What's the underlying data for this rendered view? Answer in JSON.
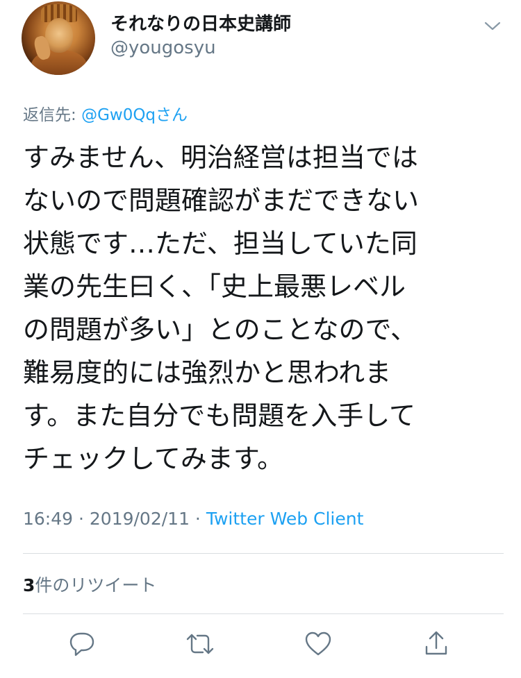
{
  "user": {
    "display_name": "それなりの日本史講師",
    "handle": "@yougosyu"
  },
  "reply": {
    "prefix": "返信先: ",
    "mention": "@Gw0Qqさん"
  },
  "tweet": {
    "text": "すみません、明治経営は担当では\nないので問題確認がまだできない\n状態です…ただ、担当していた同\n業の先生曰く、「史上最悪レベル\nの問題が多い」とのことなので、\n難易度的には強烈かと思われま\nす。また自分でも問題を入手して\nチェックしてみます。"
  },
  "meta": {
    "time": "16:49",
    "separator1": " · ",
    "date": "2019/02/11",
    "separator2": " · ",
    "client": "Twitter Web Client"
  },
  "retweets": {
    "count": "3",
    "label": "件のリツイート"
  },
  "icons": {
    "caret": "chevron-down-icon",
    "reply": "reply-icon",
    "retweet": "retweet-icon",
    "like": "like-icon",
    "share": "share-icon"
  },
  "colors": {
    "accent": "#1da1f2",
    "secondary_text": "#657786",
    "primary_text": "#14171a",
    "divider": "#d9dde1"
  }
}
